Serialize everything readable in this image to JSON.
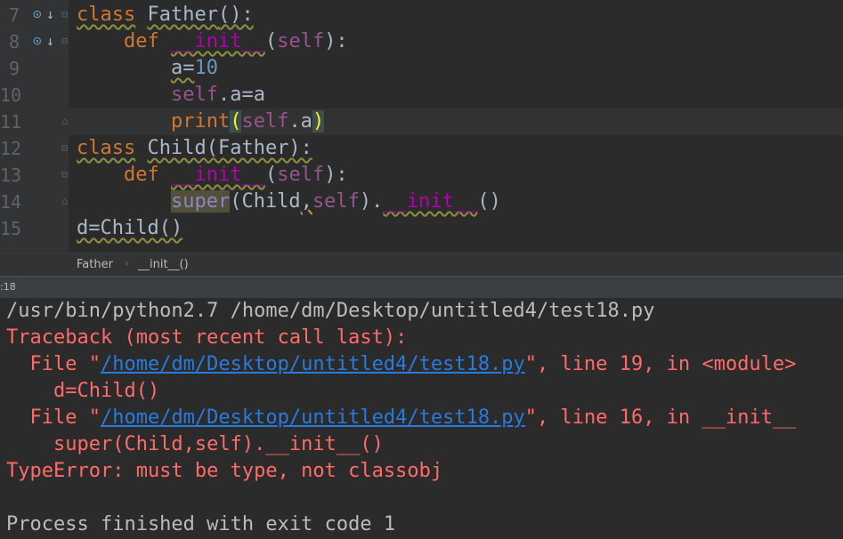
{
  "editor": {
    "lines": [
      {
        "num": "7"
      },
      {
        "num": "8"
      },
      {
        "num": "9"
      },
      {
        "num": "10"
      },
      {
        "num": "11"
      },
      {
        "num": "12"
      },
      {
        "num": "13"
      },
      {
        "num": "14"
      },
      {
        "num": "15"
      }
    ],
    "tokens": {
      "class": "class",
      "father_decl": "Father",
      "parens_colon": "():",
      "def": "def",
      "init": "__init__",
      "lparen": "(",
      "self": "self",
      "rparen_colon": "):",
      "a_eq": "a=",
      "ten": "10",
      "dot_a_eq_a": ".a=a",
      "print": "print",
      "dot_a": ".a",
      "rparen": ")",
      "child_decl": "Child",
      "father_paren": "(Father):",
      "super": "super",
      "child_arg": "(Child",
      "comma": ",",
      "close_dot": ").",
      "empty_call": "()",
      "d_eq_child": "d=Child()"
    }
  },
  "breadcrumb": {
    "class_name": "Father",
    "separator": "›",
    "method_name": "__init__()"
  },
  "console_tab": {
    "label": ":18"
  },
  "console": {
    "command": "/usr/bin/python2.7 /home/dm/Desktop/untitled4/test18.py",
    "traceback_header": "Traceback (most recent call last):",
    "frame1_prefix": "  File \"",
    "frame1_path": "/home/dm/Desktop/untitled4/test18.py",
    "frame1_suffix": "\", line 19, in <module>",
    "frame1_code": "    d=Child()",
    "frame2_prefix": "  File \"",
    "frame2_path": "/home/dm/Desktop/untitled4/test18.py",
    "frame2_suffix": "\", line 16, in __init__",
    "frame2_code": "    super(Child,self).__init__()",
    "error": "TypeError: must be type, not classobj",
    "exit_message": "Process finished with exit code 1"
  },
  "colors": {
    "background": "#2b2b2b",
    "keyword": "#cc7832",
    "magic_method": "#b200b2",
    "self": "#94558d",
    "number": "#6897bb",
    "error_text": "#ff6b68",
    "link": "#287bde"
  },
  "icons": [
    "override-method-icon",
    "implemented-arrow-icon",
    "fold-marker-icon"
  ]
}
